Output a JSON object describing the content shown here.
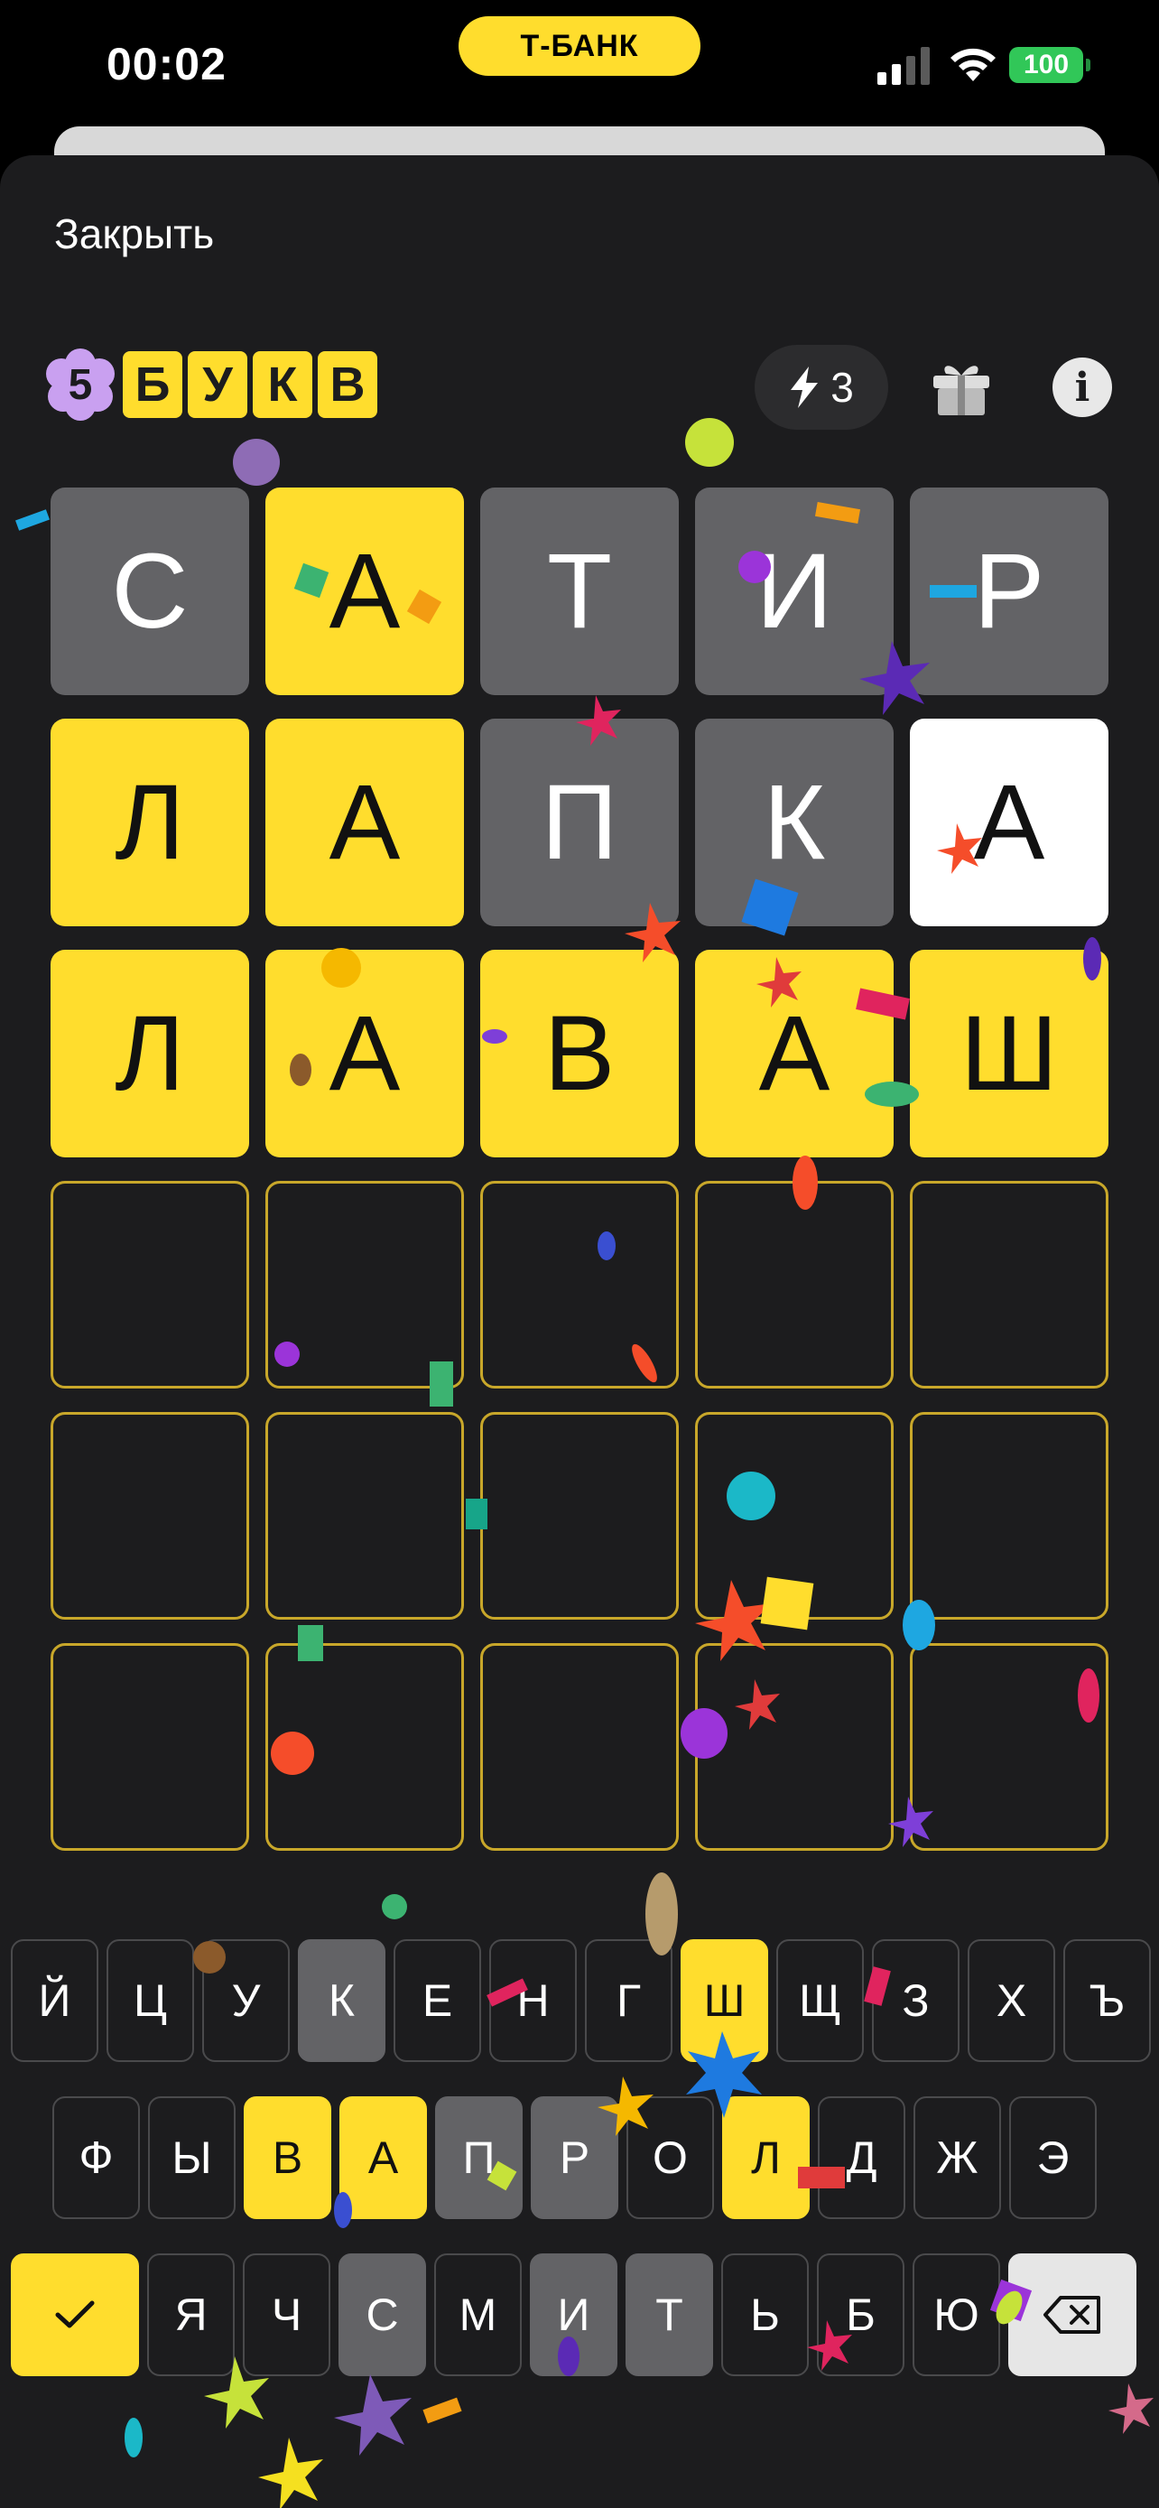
{
  "status": {
    "time": "00:02",
    "bank_label": "Т-БАНК",
    "battery": "100"
  },
  "header": {
    "close_label": "Закрыть"
  },
  "logo": {
    "number": "5",
    "letters": [
      "Б",
      "У",
      "К",
      "В"
    ]
  },
  "energy": {
    "count": "3",
    "icon": "lightning-icon"
  },
  "toolbar": {
    "gift_icon": "gift-icon",
    "info_icon": "info-icon"
  },
  "board": {
    "rows": [
      [
        {
          "l": "С",
          "s": "gray"
        },
        {
          "l": "А",
          "s": "yellow"
        },
        {
          "l": "Т",
          "s": "gray"
        },
        {
          "l": "И",
          "s": "gray"
        },
        {
          "l": "Р",
          "s": "gray"
        }
      ],
      [
        {
          "l": "Л",
          "s": "yellow"
        },
        {
          "l": "А",
          "s": "yellow"
        },
        {
          "l": "П",
          "s": "gray"
        },
        {
          "l": "К",
          "s": "gray"
        },
        {
          "l": "А",
          "s": "white"
        }
      ],
      [
        {
          "l": "Л",
          "s": "yellow"
        },
        {
          "l": "А",
          "s": "yellow"
        },
        {
          "l": "В",
          "s": "yellow"
        },
        {
          "l": "А",
          "s": "yellow"
        },
        {
          "l": "Ш",
          "s": "yellow"
        }
      ],
      [
        {
          "l": "",
          "s": "empty"
        },
        {
          "l": "",
          "s": "empty"
        },
        {
          "l": "",
          "s": "empty"
        },
        {
          "l": "",
          "s": "empty"
        },
        {
          "l": "",
          "s": "empty"
        }
      ],
      [
        {
          "l": "",
          "s": "empty"
        },
        {
          "l": "",
          "s": "empty"
        },
        {
          "l": "",
          "s": "empty"
        },
        {
          "l": "",
          "s": "empty"
        },
        {
          "l": "",
          "s": "empty"
        }
      ],
      [
        {
          "l": "",
          "s": "empty"
        },
        {
          "l": "",
          "s": "empty"
        },
        {
          "l": "",
          "s": "empty"
        },
        {
          "l": "",
          "s": "empty"
        },
        {
          "l": "",
          "s": "empty"
        }
      ]
    ]
  },
  "keyboard": {
    "row1": [
      {
        "k": "Й",
        "s": ""
      },
      {
        "k": "Ц",
        "s": ""
      },
      {
        "k": "У",
        "s": ""
      },
      {
        "k": "К",
        "s": "gray"
      },
      {
        "k": "Е",
        "s": ""
      },
      {
        "k": "Н",
        "s": ""
      },
      {
        "k": "Г",
        "s": ""
      },
      {
        "k": "Ш",
        "s": "yellow"
      },
      {
        "k": "Щ",
        "s": ""
      },
      {
        "k": "З",
        "s": ""
      },
      {
        "k": "Х",
        "s": ""
      },
      {
        "k": "Ъ",
        "s": ""
      }
    ],
    "row2": [
      {
        "k": "Ф",
        "s": ""
      },
      {
        "k": "Ы",
        "s": ""
      },
      {
        "k": "В",
        "s": "yellow"
      },
      {
        "k": "А",
        "s": "yellow"
      },
      {
        "k": "П",
        "s": "gray"
      },
      {
        "k": "Р",
        "s": "gray"
      },
      {
        "k": "О",
        "s": ""
      },
      {
        "k": "Л",
        "s": "yellow"
      },
      {
        "k": "Д",
        "s": ""
      },
      {
        "k": "Ж",
        "s": ""
      },
      {
        "k": "Э",
        "s": ""
      }
    ],
    "row3": [
      {
        "k": "Я",
        "s": ""
      },
      {
        "k": "Ч",
        "s": ""
      },
      {
        "k": "С",
        "s": "gray"
      },
      {
        "k": "М",
        "s": ""
      },
      {
        "k": "И",
        "s": "gray"
      },
      {
        "k": "Т",
        "s": "gray"
      },
      {
        "k": "Ь",
        "s": ""
      },
      {
        "k": "Б",
        "s": ""
      },
      {
        "k": "Ю",
        "s": ""
      }
    ],
    "enter_icon": "checkmark-icon",
    "backspace_icon": "backspace-icon"
  },
  "colors": {
    "yellow": "#ffdd2d",
    "gray": "#636366",
    "background": "#1c1c1e",
    "empty_border": "#c8a72a"
  }
}
